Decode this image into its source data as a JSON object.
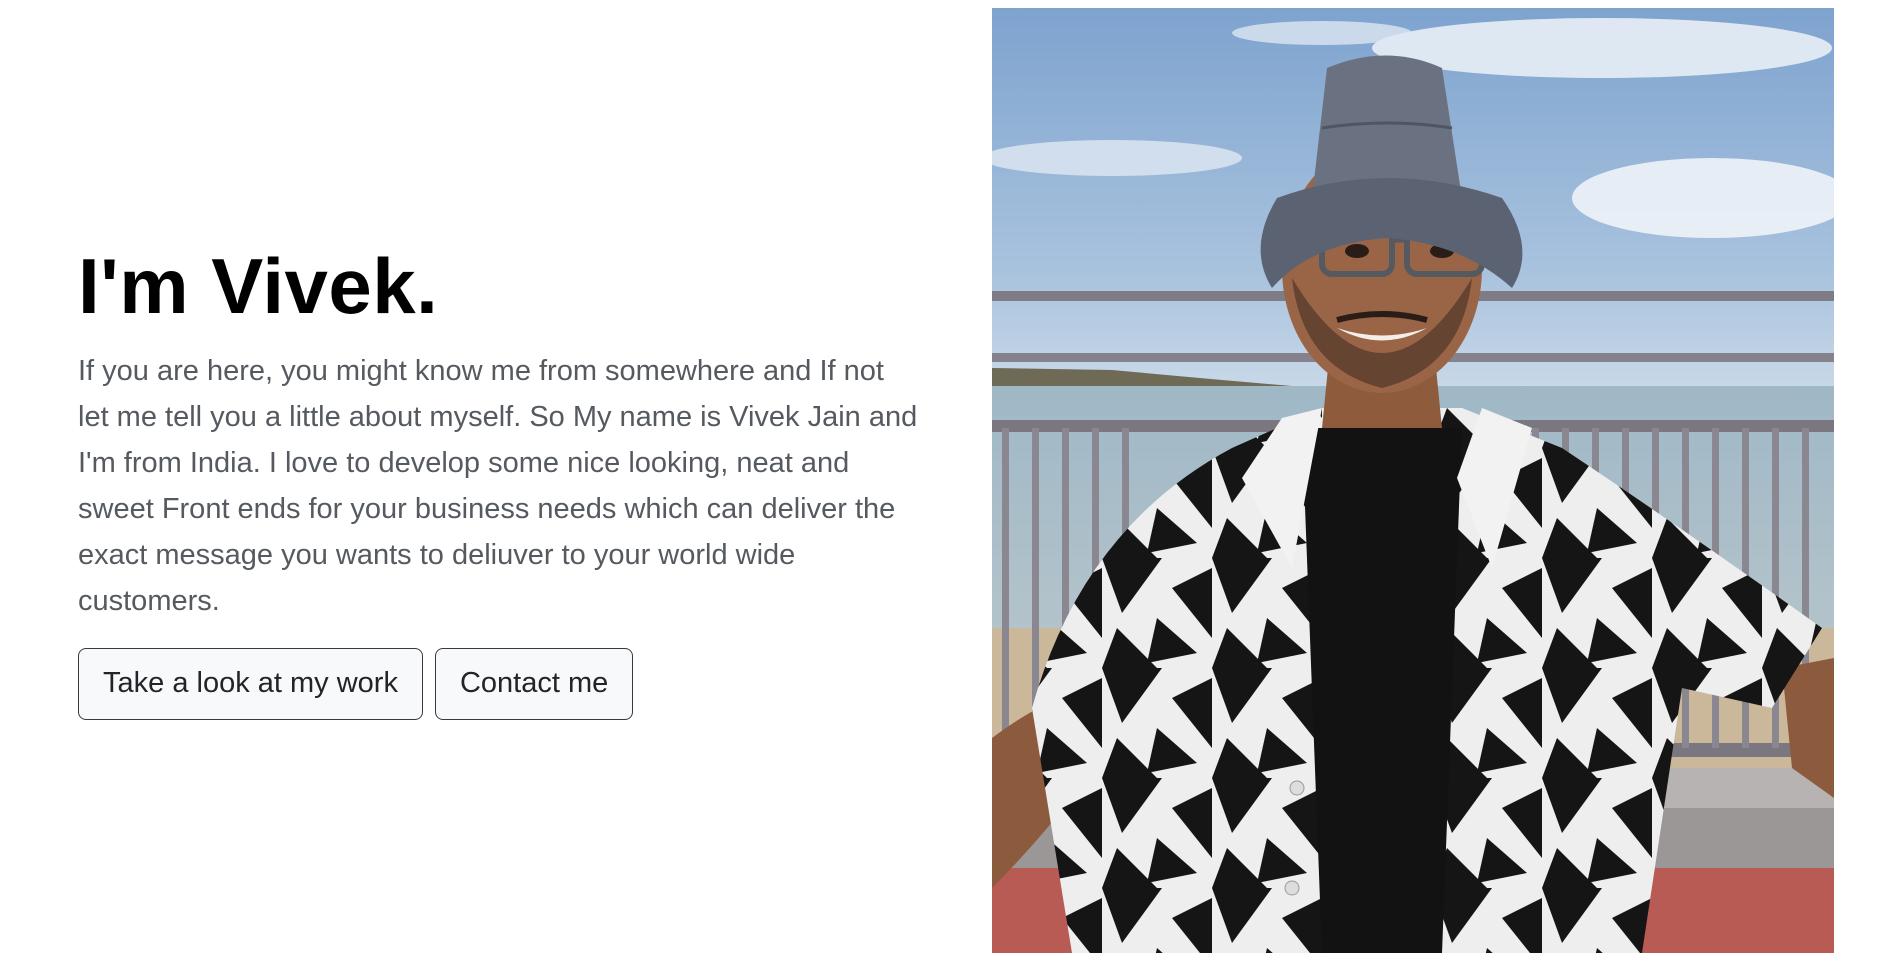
{
  "hero": {
    "heading": "I'm Vivek.",
    "paragraph": "If you are here, you might know me from somewhere and If not let me tell you a little about myself. So My name is Vivek Jain and I'm from India. I love to develop some nice looking, neat and sweet Front ends for your business needs which can deliver the exact message you wants to deliuver to your world wide customers.",
    "buttons": {
      "work_label": "Take a look at my work",
      "contact_label": "Contact me"
    }
  }
}
